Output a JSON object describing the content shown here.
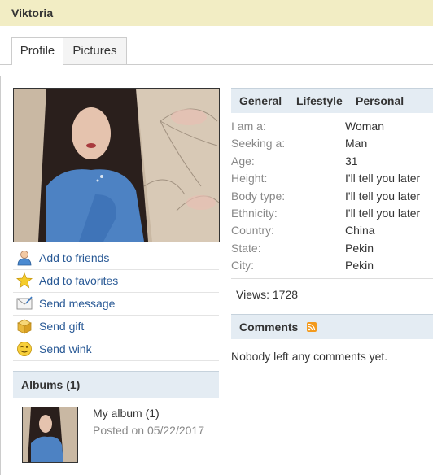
{
  "header": {
    "title": "Viktoria"
  },
  "tabs": [
    {
      "label": "Profile",
      "active": true
    },
    {
      "label": "Pictures",
      "active": false
    }
  ],
  "actions": [
    {
      "label": "Add to friends",
      "icon": "add-friend-icon"
    },
    {
      "label": "Add to favorites",
      "icon": "star-icon"
    },
    {
      "label": "Send message",
      "icon": "envelope-icon"
    },
    {
      "label": "Send gift",
      "icon": "gift-box-icon"
    },
    {
      "label": "Send wink",
      "icon": "wink-smiley-icon"
    }
  ],
  "albums": {
    "heading": "Albums (1)",
    "items": [
      {
        "name": "My album (1)",
        "posted": "Posted on 05/22/2017"
      }
    ]
  },
  "info": {
    "tabs": [
      "General",
      "Lifestyle",
      "Personal"
    ],
    "rows": [
      {
        "label": "I am a:",
        "value": "Woman"
      },
      {
        "label": "Seeking a:",
        "value": "Man"
      },
      {
        "label": "Age:",
        "value": "31"
      },
      {
        "label": "Height:",
        "value": "I'll tell you later"
      },
      {
        "label": "Body type:",
        "value": "I'll tell you later"
      },
      {
        "label": "Ethnicity:",
        "value": "I'll tell you later"
      },
      {
        "label": "Country:",
        "value": "China"
      },
      {
        "label": "State:",
        "value": "Pekin"
      },
      {
        "label": "City:",
        "value": "Pekin"
      }
    ],
    "views": "Views: 1728"
  },
  "comments": {
    "heading": "Comments",
    "empty_text": "Nobody left any comments yet."
  },
  "colors": {
    "header_bg": "#f2edc4",
    "section_bg": "#e4ecf3",
    "link": "#2a5a96",
    "muted": "#888888",
    "rss": "#f39a1d"
  }
}
